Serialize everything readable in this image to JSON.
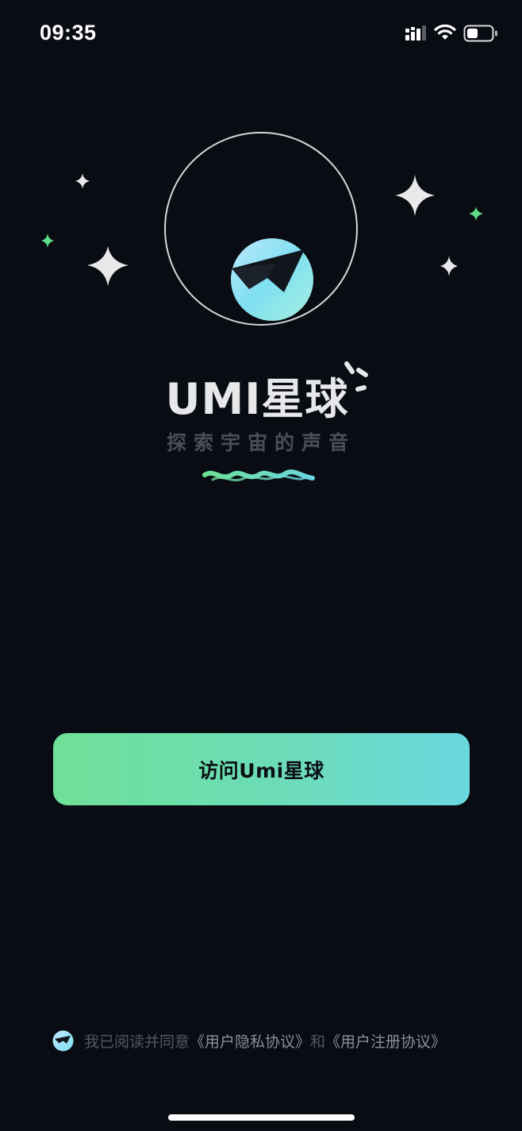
{
  "status_bar": {
    "time": "09:35",
    "icons": [
      "cellular-signal-icon",
      "wifi-icon",
      "battery-icon"
    ]
  },
  "brand": {
    "title": "UMI星球",
    "slogan": "探索宇宙的声音",
    "logo_icon": "umi-planet-logo",
    "colors": {
      "accent_green": "#6ee097",
      "accent_cyan": "#6ad8e0",
      "background": "#090c13"
    }
  },
  "primary_action": {
    "label": "访问Umi星球"
  },
  "agreement": {
    "prefix": "我已阅读并同意",
    "privacy_link": "《用户隐私协议》",
    "conjunction": "和",
    "register_link": "《用户注册协议》"
  }
}
